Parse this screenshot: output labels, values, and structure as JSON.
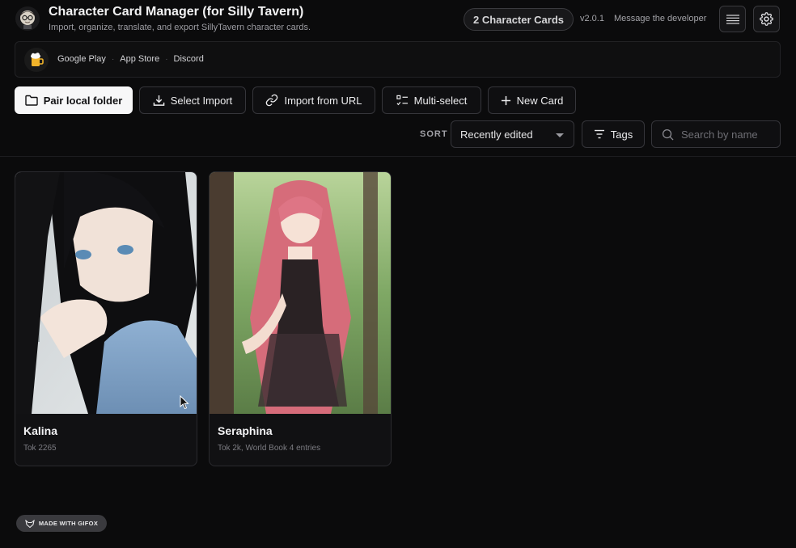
{
  "header": {
    "title": "Character Card Manager (for Silly Tavern)",
    "subtitle": "Import, organize, translate, and export SillyTavern character cards.",
    "card_count": "2 Character Cards",
    "version": "v2.0.1",
    "developer_link": "Message the developer",
    "icons": [
      "avatar-icon",
      "list-view-icon",
      "gear-icon"
    ]
  },
  "links_bar": {
    "logo_icon": "beer-mug-icon",
    "links": [
      "Google Play",
      "App Store",
      "Discord"
    ]
  },
  "toolbar": {
    "pair_folder": "Pair local folder",
    "select_import": "Select Import",
    "import_url": "Import from URL",
    "multi_select": "Multi-select",
    "new_card": "New Card"
  },
  "filters": {
    "sort_label": "SORT",
    "sort_value": "Recently edited",
    "tags_label": "Tags",
    "search_placeholder": "Search by name"
  },
  "cards": [
    {
      "name": "Kalina",
      "meta": "Tok 2265",
      "image": "anime girl with long black hair resting chin on hand"
    },
    {
      "name": "Seraphina",
      "meta": "Tok 2k, World Book 4 entries",
      "image": "anime girl with long pink hair in black dress in forest"
    }
  ],
  "watermark": "MADE WITH GIFOX",
  "colors": {
    "background": "#0b0b0c",
    "primary_button": "#f7f7f8",
    "border": "#35353a"
  }
}
